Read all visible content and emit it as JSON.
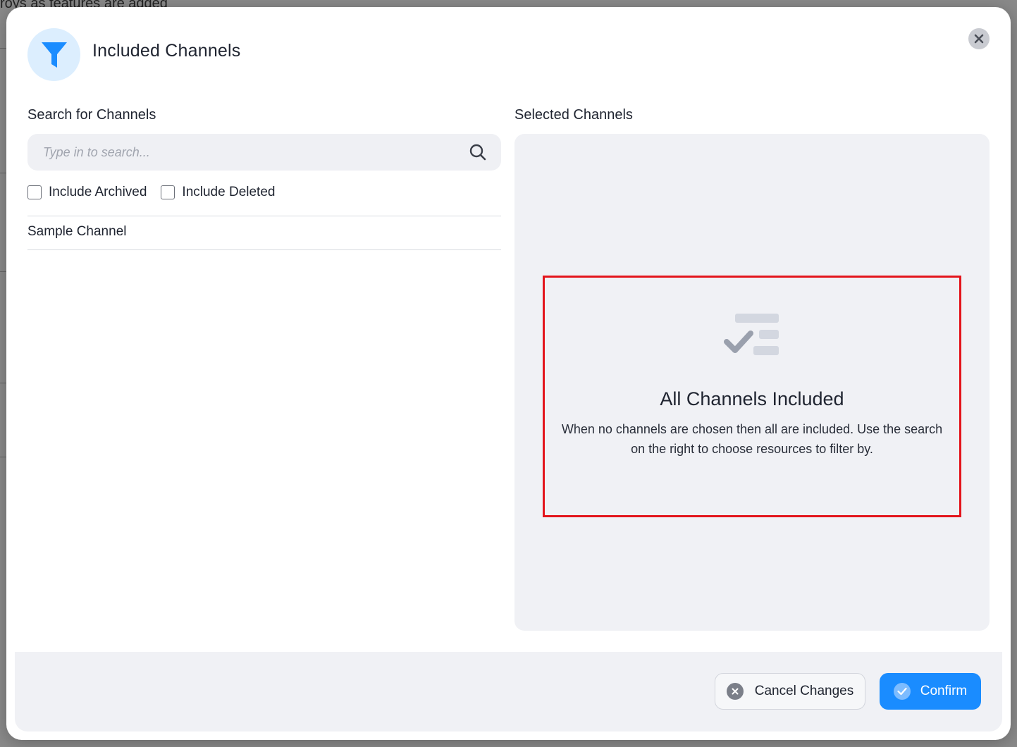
{
  "background": {
    "partial_text": "roys as features are added"
  },
  "modal": {
    "title": "Included Channels",
    "header_icon": "filter-icon",
    "close_icon": "close-icon"
  },
  "search_section": {
    "label": "Search for Channels",
    "search": {
      "placeholder": "Type in to search...",
      "value": ""
    },
    "checkboxes": [
      {
        "label": "Include Archived",
        "checked": false
      },
      {
        "label": "Include Deleted",
        "checked": false
      }
    ],
    "channels": [
      "Sample Channel"
    ]
  },
  "selected_section": {
    "label": "Selected Channels",
    "empty_state": {
      "icon": "checklist-icon",
      "title": "All Channels Included",
      "description": "When no channels are chosen then all are included. Use the search on the right to choose resources to filter by."
    }
  },
  "footer": {
    "cancel_label": "Cancel Changes",
    "confirm_label": "Confirm"
  },
  "colors": {
    "accent": "#1a8cff",
    "highlight_border": "#e3141b",
    "panel_bg": "#f0f1f5"
  }
}
